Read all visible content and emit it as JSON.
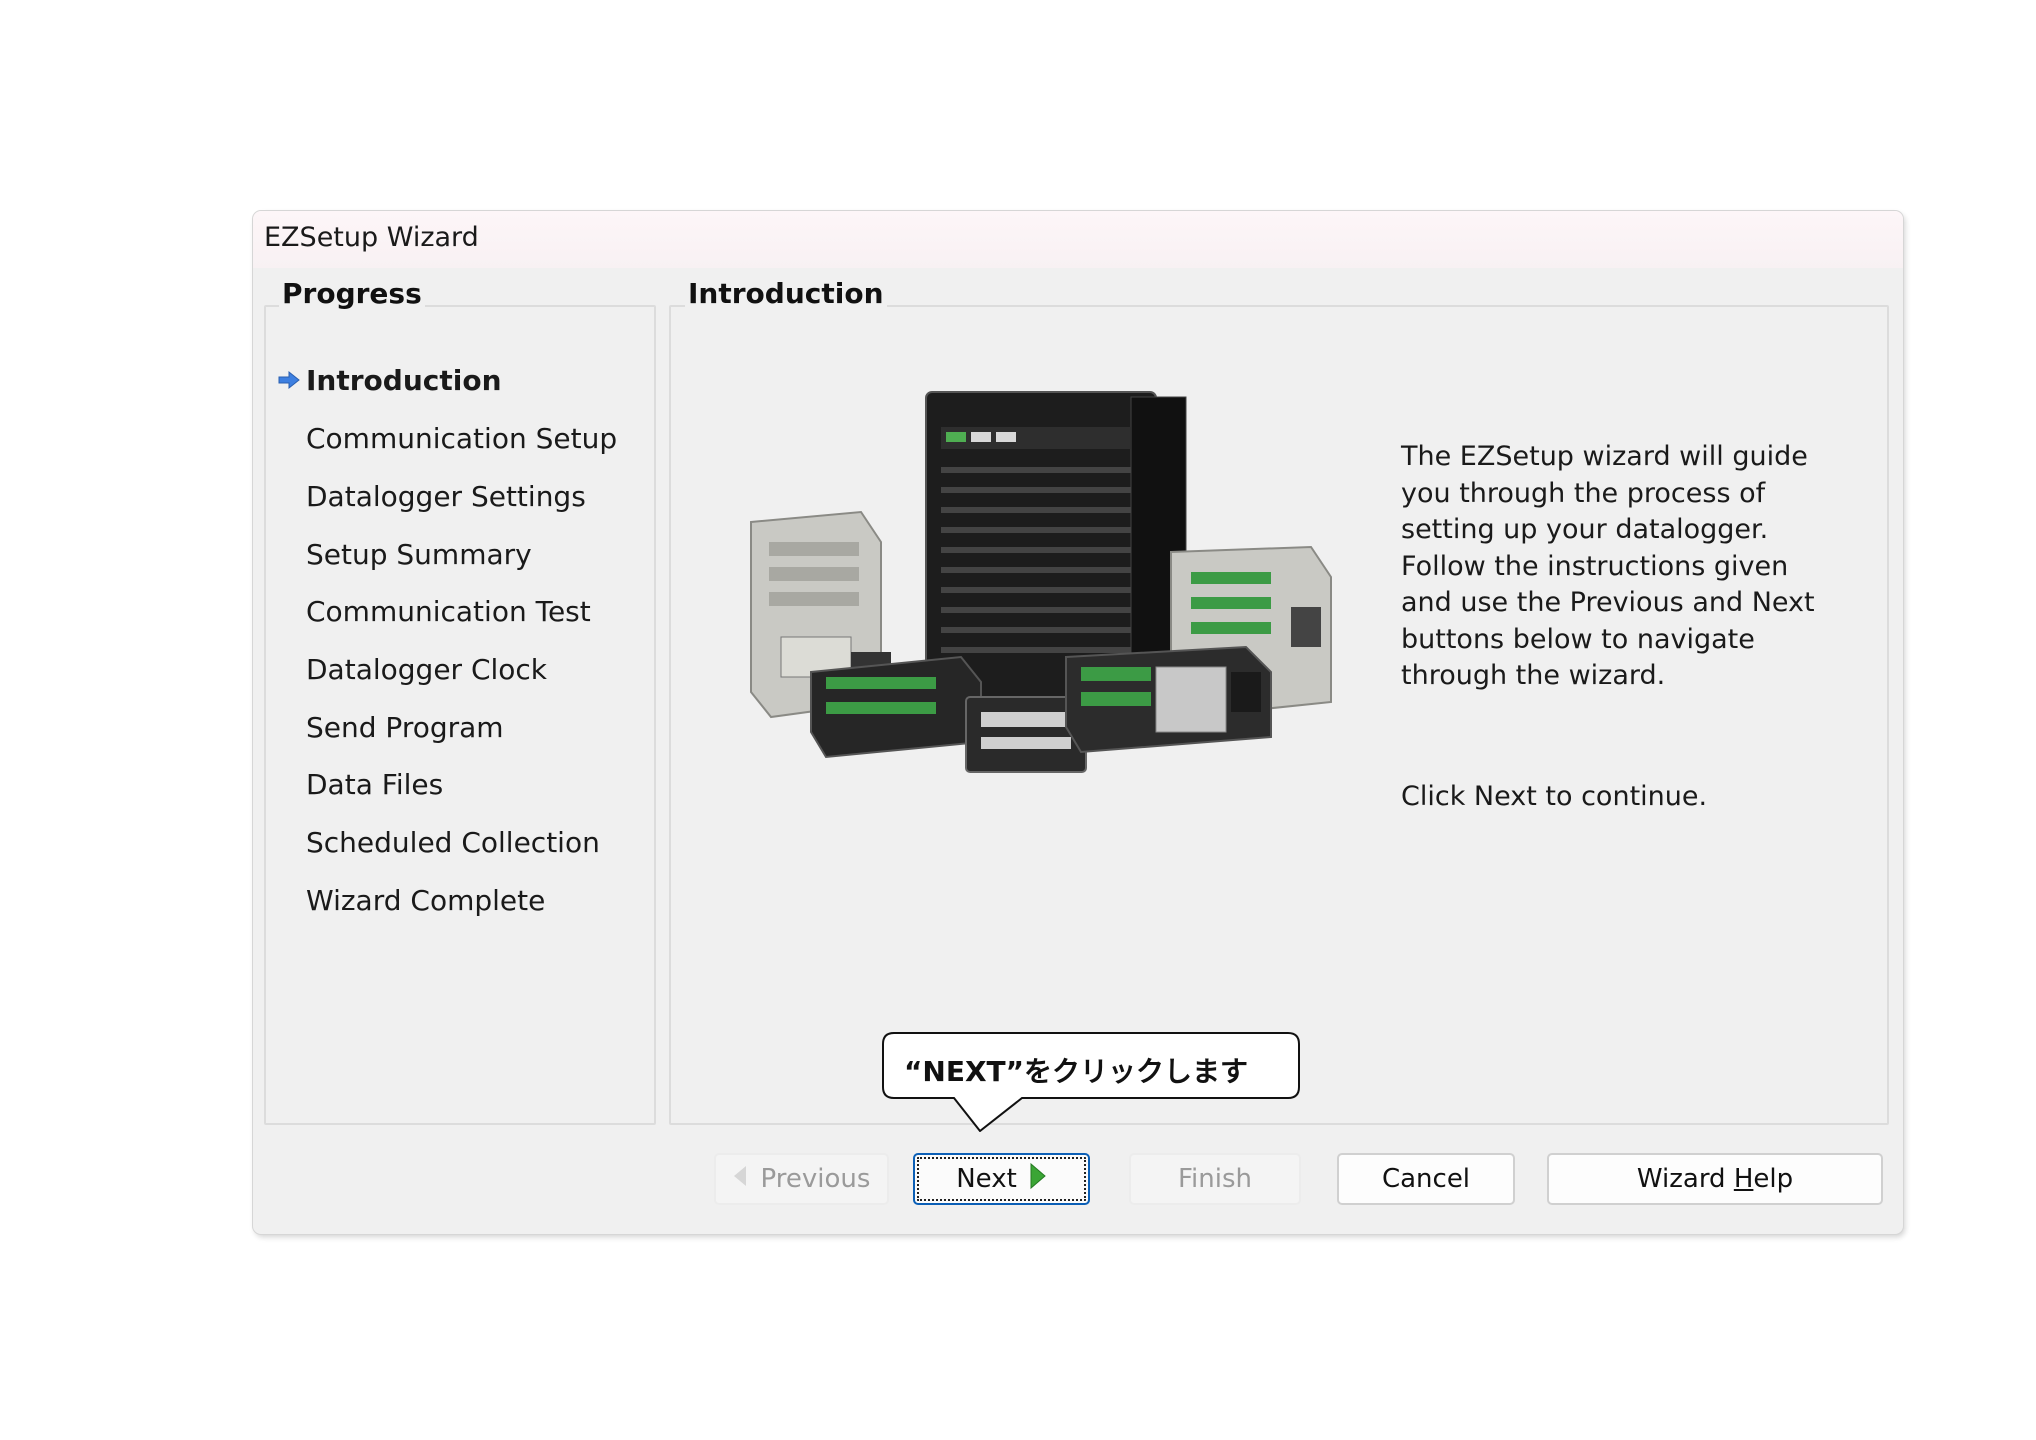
{
  "window": {
    "title": "EZSetup Wizard"
  },
  "progress": {
    "heading": "Progress",
    "current_index": 0,
    "steps": [
      {
        "label": "Introduction"
      },
      {
        "label": "Communication Setup"
      },
      {
        "label": "Datalogger Settings"
      },
      {
        "label": "Setup Summary"
      },
      {
        "label": "Communication Test"
      },
      {
        "label": "Datalogger Clock"
      },
      {
        "label": "Send Program"
      },
      {
        "label": "Data Files"
      },
      {
        "label": "Scheduled Collection"
      },
      {
        "label": "Wizard Complete"
      }
    ]
  },
  "main": {
    "heading": "Introduction",
    "description": "The EZSetup wizard will guide you through the process of setting up your datalogger. Follow the instructions given and use the Previous and Next buttons below to navigate through the wizard.",
    "continue_text": "Click Next to continue."
  },
  "buttons": {
    "previous": "Previous",
    "next": "Next",
    "finish": "Finish",
    "cancel": "Cancel",
    "help_prefix": "Wizard ",
    "help_mnemonic": "H",
    "help_suffix": "elp"
  },
  "annotation": {
    "text": "“NEXT”をクリックします"
  },
  "colors": {
    "accent": "#0b5fb6",
    "arrow_icon": "#3d7fe0",
    "next_arrow": "#3aa535",
    "window_bg": "#f0f0f0"
  },
  "icons": {
    "current_step": "arrow-right-icon",
    "next": "play-triangle-icon",
    "previous": "back-triangle-icon"
  }
}
